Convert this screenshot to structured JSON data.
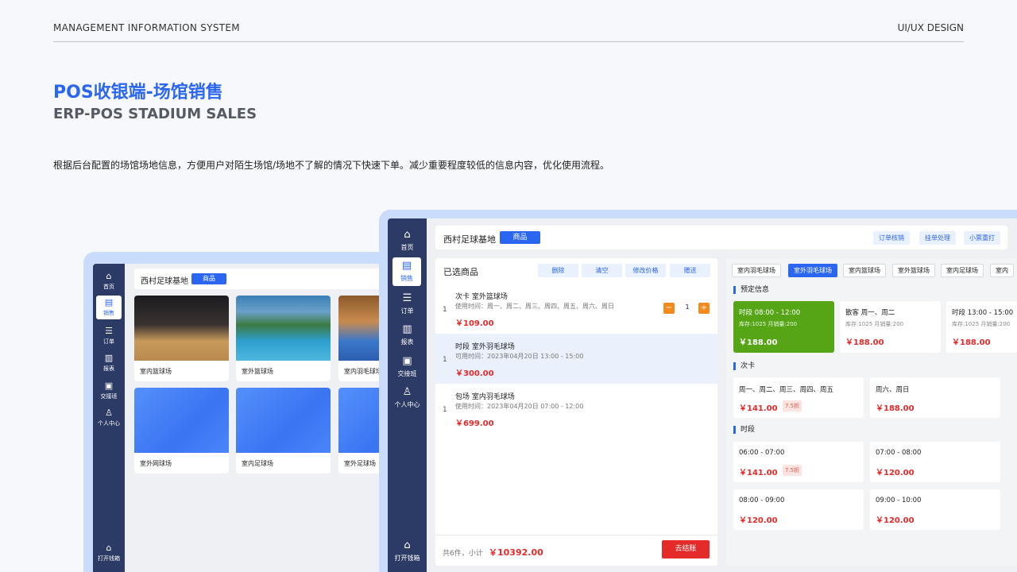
{
  "header": {
    "left": "MANAGEMENT INFORMATION SYSTEM",
    "right": "UI/UX DESIGN",
    "title_cn": "POS收银端-场馆销售",
    "title_en": "ERP-POS STADIUM SALES",
    "description": "根据后台配置的场馆场地信息，方便用户对陌生场馆/场地不了解的情况下快速下单。减少重要程度较低的信息内容，优化使用流程。"
  },
  "back_screen": {
    "sidebar": [
      {
        "label": "首页",
        "icon": "home-icon"
      },
      {
        "label": "销售",
        "icon": "sales-icon"
      },
      {
        "label": "订单",
        "icon": "order-icon"
      },
      {
        "label": "报表",
        "icon": "report-icon"
      },
      {
        "label": "交接班",
        "icon": "handover-icon"
      },
      {
        "label": "个人中心",
        "icon": "user-icon"
      }
    ],
    "drawer_label": "打开钱箱",
    "venue": "西村足球基地",
    "tab": "商品",
    "cards": [
      {
        "label": "室内篮球场"
      },
      {
        "label": "室外篮球场"
      },
      {
        "label": "室内羽毛球场"
      },
      {
        "label": "室外网球场"
      },
      {
        "label": "室内足球场"
      },
      {
        "label": "室外足球场"
      }
    ]
  },
  "front_screen": {
    "sidebar": [
      {
        "label": "首页",
        "icon": "home-icon"
      },
      {
        "label": "销售",
        "icon": "sales-icon"
      },
      {
        "label": "订单",
        "icon": "order-icon"
      },
      {
        "label": "报表",
        "icon": "report-icon"
      },
      {
        "label": "交接班",
        "icon": "handover-icon"
      },
      {
        "label": "个人中心",
        "icon": "user-icon"
      }
    ],
    "drawer_label": "打开钱箱",
    "venue": "西村足球基地",
    "tab": "商品",
    "top_buttons": [
      "订单核销",
      "挂单处理",
      "小票重打"
    ],
    "selected_title": "已选商品",
    "order_actions": [
      "删除",
      "清空",
      "修改价格",
      "赠送"
    ],
    "items": [
      {
        "num": "1",
        "name": "次卡 室外篮球场",
        "time": "使用时间：周一、周二、周三、周四、周五、周六、周日",
        "price": "￥109.00",
        "qty": "1",
        "minus": "−",
        "plus": "+"
      },
      {
        "num": "1",
        "name": "时段 室外羽毛球场",
        "time": "可用时间：2023年04月20日 13:00 - 15:00",
        "price": "￥300.00"
      },
      {
        "num": "1",
        "name": "包场 室内羽毛球场",
        "time": "使用时间：2023年04月20日 07:00 - 12:00",
        "price": "￥699.00"
      }
    ],
    "footer": {
      "count_label": "共6件，小计",
      "total": "￥10392.00",
      "checkout": "去结账"
    },
    "venue_tabs": [
      "室内羽毛球场",
      "室外羽毛球场",
      "室内篮球场",
      "室外篮球场",
      "室内足球场",
      "室内"
    ],
    "sections": {
      "reserve": "预定信息",
      "card": "次卡",
      "period": "时段"
    },
    "reserve": [
      {
        "title": "时段 08:00 - 12:00",
        "sub": "库存:1025  月销量:200",
        "price": "￥188.00"
      },
      {
        "title": "散客 周一、周二",
        "sub": "库存:1025  月销量:200",
        "price": "￥188.00"
      },
      {
        "title": "时段 13:00 - 15:00",
        "sub": "库存:1025  月销量:200",
        "price": "￥188.00"
      }
    ],
    "card_items": [
      {
        "title": "周一、周二、周三、周四、周五",
        "price": "￥141.00",
        "discount": "7.5折"
      },
      {
        "title": "周六、周日",
        "price": "￥188.00"
      }
    ],
    "period_items": [
      {
        "title": "06:00 - 07:00",
        "price": "￥141.00",
        "discount": "7.5折"
      },
      {
        "title": "07:00 - 08:00",
        "price": "￥120.00"
      },
      {
        "title": "08:00 - 09:00",
        "price": "￥120.00"
      },
      {
        "title": "09:00 - 10:00",
        "price": "￥120.00"
      }
    ]
  }
}
